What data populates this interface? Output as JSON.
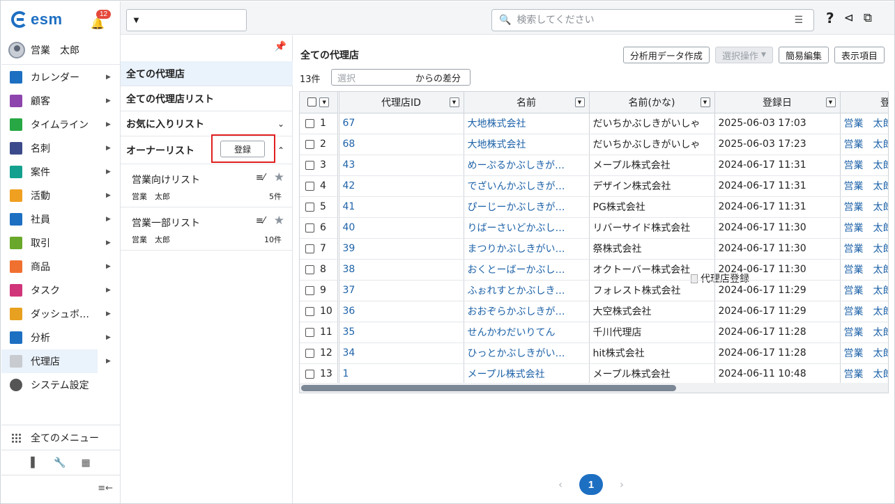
{
  "app": {
    "logo": "esm",
    "notifications": "12",
    "user": "営業　太郎"
  },
  "nav": [
    {
      "label": "カレンダー",
      "icon": "calendar-icon",
      "color": "#1d6fc2"
    },
    {
      "label": "顧客",
      "icon": "building-icon",
      "color": "#8e44ad"
    },
    {
      "label": "タイムライン",
      "icon": "chat-icon",
      "color": "#27a844"
    },
    {
      "label": "名刺",
      "icon": "card-icon",
      "color": "#3b4a8a"
    },
    {
      "label": "案件",
      "icon": "folder-icon",
      "color": "#14a08f"
    },
    {
      "label": "活動",
      "icon": "clipboard-icon",
      "color": "#f0a020"
    },
    {
      "label": "社員",
      "icon": "person-icon",
      "color": "#1d6fc2"
    },
    {
      "label": "取引",
      "icon": "ledger-icon",
      "color": "#6aa82b"
    },
    {
      "label": "商品",
      "icon": "box-icon",
      "color": "#f07030"
    },
    {
      "label": "タスク",
      "icon": "check-icon",
      "color": "#d0357a"
    },
    {
      "label": "ダッシュボ…",
      "icon": "dashboard-icon",
      "color": "#e8a020"
    },
    {
      "label": "分析",
      "icon": "chart-icon",
      "color": "#1d6fc2"
    },
    {
      "label": "代理店",
      "icon": "agency-icon",
      "color": "#c8cbd0"
    },
    {
      "label": "システム設定",
      "icon": "gear-icon",
      "color": "#555555"
    }
  ],
  "nav_all": "全てのメニュー",
  "topbar": {
    "register": "代理店登録",
    "search_placeholder": "検索してください"
  },
  "lists": {
    "all": "全ての代理店",
    "all_lists": "全ての代理店リスト",
    "fav": "お気に入りリスト",
    "owner": "オーナーリスト",
    "owner_register": "登録",
    "items": [
      {
        "name": "営業向けリスト",
        "owner": "営業　太郎",
        "count": "5件"
      },
      {
        "name": "営業一部リスト",
        "owner": "営業　太郎",
        "count": "10件"
      }
    ]
  },
  "main": {
    "title": "全ての代理店",
    "buttons": {
      "analysis": "分析用データ作成",
      "select_op": "選択操作",
      "quick_edit": "簡易編集",
      "columns": "表示項目"
    },
    "count": "13件",
    "diff_placeholder": "選択",
    "diff_label": "からの差分",
    "columns": [
      "代理店ID",
      "名前",
      "名前(かな)",
      "登録日",
      "登"
    ],
    "rows": [
      {
        "n": "1",
        "id": "67",
        "name": "大地株式会社",
        "kana": "だいちかぶしきがいしゃ",
        "date": "2025-06-03 17:03",
        "owner": "営業　太郎"
      },
      {
        "n": "2",
        "id": "68",
        "name": "大地株式会社",
        "kana": "だいちかぶしきがいしゃ",
        "date": "2025-06-03 17:23",
        "owner": "営業　太郎"
      },
      {
        "n": "3",
        "id": "43",
        "name": "めーぷるかぶしきが…",
        "kana": "メープル株式会社",
        "date": "2024-06-17 11:31",
        "owner": "営業　太郎"
      },
      {
        "n": "4",
        "id": "42",
        "name": "でざいんかぶしきが…",
        "kana": "デザイン株式会社",
        "date": "2024-06-17 11:31",
        "owner": "営業　太郎"
      },
      {
        "n": "5",
        "id": "41",
        "name": "ぴーじーかぶしきが…",
        "kana": "PG株式会社",
        "date": "2024-06-17 11:31",
        "owner": "営業　太郎"
      },
      {
        "n": "6",
        "id": "40",
        "name": "りばーさいどかぶし…",
        "kana": "リバーサイド株式会社",
        "date": "2024-06-17 11:30",
        "owner": "営業　太郎"
      },
      {
        "n": "7",
        "id": "39",
        "name": "まつりかぶしきがい…",
        "kana": "祭株式会社",
        "date": "2024-06-17 11:30",
        "owner": "営業　太郎"
      },
      {
        "n": "8",
        "id": "38",
        "name": "おくとーばーかぶし…",
        "kana": "オクトーバー株式会社",
        "date": "2024-06-17 11:30",
        "owner": "営業　太郎"
      },
      {
        "n": "9",
        "id": "37",
        "name": "ふぉれすとかぶしき…",
        "kana": "フォレスト株式会社",
        "date": "2024-06-17 11:29",
        "owner": "営業　太郎"
      },
      {
        "n": "10",
        "id": "36",
        "name": "おおぞらかぶしきが…",
        "kana": "大空株式会社",
        "date": "2024-06-17 11:29",
        "owner": "営業　太郎"
      },
      {
        "n": "11",
        "id": "35",
        "name": "せんかわだいりてん",
        "kana": "千川代理店",
        "date": "2024-06-17 11:28",
        "owner": "営業　太郎"
      },
      {
        "n": "12",
        "id": "34",
        "name": "ひっとかぶしきがい…",
        "kana": "hit株式会社",
        "date": "2024-06-17 11:28",
        "owner": "営業　太郎"
      },
      {
        "n": "13",
        "id": "1",
        "name": "メープル株式会社",
        "kana": "メープル株式会社",
        "date": "2024-06-11 10:48",
        "owner": "営業　太郎"
      }
    ],
    "page": "1"
  }
}
